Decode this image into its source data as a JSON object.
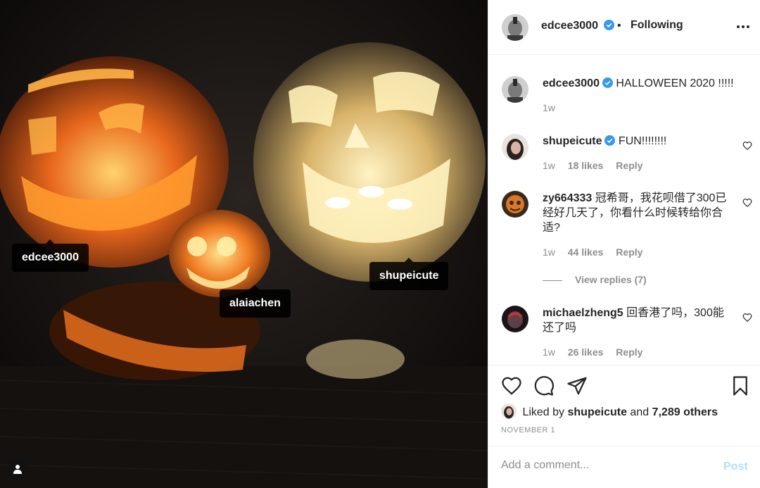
{
  "photo": {
    "tags": [
      "edcee3000",
      "alaiachen",
      "shupeicute"
    ],
    "user_tag_icon": "user-tag-icon"
  },
  "header": {
    "username": "edcee3000",
    "separator": "•",
    "follow_status": "Following",
    "more_icon": "more-options-icon"
  },
  "caption": {
    "username": "edcee3000",
    "text": "HALLOWEEN 2020 !!!!!",
    "time": "1w"
  },
  "comments": [
    {
      "username": "shupeicute",
      "verified": true,
      "text": "FUN!!!!!!!!",
      "time": "1w",
      "likes": "18 likes",
      "reply": "Reply"
    },
    {
      "username": "zy664333",
      "verified": false,
      "text": "冠希哥，我花呗借了300已经好几天了，你看什么时候转给你合适?",
      "time": "1w",
      "likes": "44 likes",
      "reply": "Reply"
    },
    {
      "username": "michaelzheng5",
      "verified": false,
      "text": "回香港了吗，300能还了吗",
      "time": "1w",
      "likes": "26 likes",
      "reply": "Reply"
    }
  ],
  "view_replies": "View replies (7)",
  "liked_by": {
    "prefix": "Liked by",
    "user": "shupeicute",
    "and": "and",
    "others": "7,289 others"
  },
  "post_date": "NOVEMBER 1",
  "comment_box": {
    "placeholder": "Add a comment...",
    "post_label": "Post"
  },
  "colors": {
    "verified": "#3897f0",
    "muted": "#8e8e8e",
    "post_disabled": "#b2dffc",
    "pumpkin_glow": "#ff8a1c"
  }
}
